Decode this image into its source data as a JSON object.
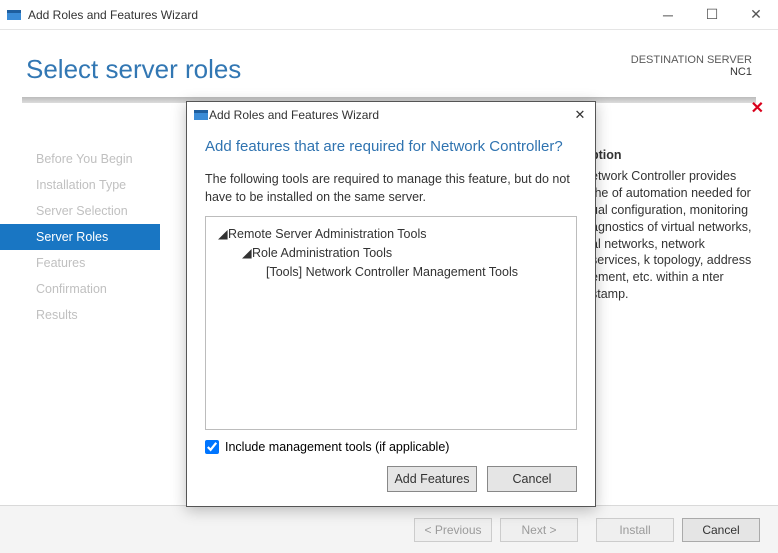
{
  "window": {
    "title": "Add Roles and Features Wizard"
  },
  "header": {
    "title": "Select server roles",
    "destination_label": "DESTINATION SERVER",
    "destination_server": "NC1"
  },
  "nav": {
    "items": [
      {
        "label": "Before You Begin",
        "active": false
      },
      {
        "label": "Installation Type",
        "active": false
      },
      {
        "label": "Server Selection",
        "active": false
      },
      {
        "label": "Server Roles",
        "active": true
      },
      {
        "label": "Features",
        "active": false
      },
      {
        "label": "Confirmation",
        "active": false
      },
      {
        "label": "Results",
        "active": false
      }
    ]
  },
  "description": {
    "heading_suffix": "ption",
    "text": "etwork Controller provides the of automation needed for ual configuration, monitoring agnostics of virtual networks, al networks, network services, k topology, address ement, etc. within a nter stamp."
  },
  "footer": {
    "previous": "< Previous",
    "next": "Next >",
    "install": "Install",
    "cancel": "Cancel"
  },
  "modal": {
    "title": "Add Roles and Features Wizard",
    "heading": "Add features that are required for Network Controller?",
    "explain": "The following tools are required to manage this feature, but do not have to be installed on the same server.",
    "tree": {
      "lvl1": "Remote Server Administration Tools",
      "lvl2": "Role Administration Tools",
      "lvl3": "[Tools] Network Controller Management Tools"
    },
    "include_label": "Include management tools (if applicable)",
    "include_checked": true,
    "add_features": "Add Features",
    "cancel": "Cancel"
  }
}
